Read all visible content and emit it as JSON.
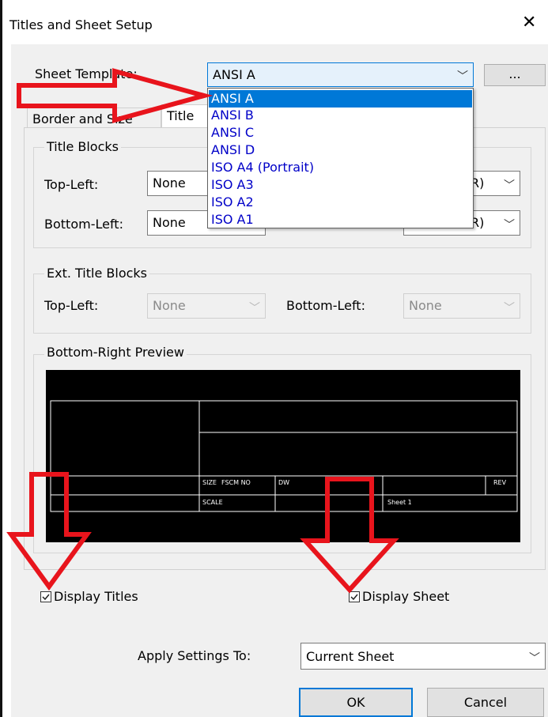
{
  "window": {
    "title": "Titles and Sheet Setup",
    "close_glyph": "✕"
  },
  "sheet_template": {
    "label": "Sheet Template:",
    "selected": "ANSI A",
    "more_button": "...",
    "options": [
      "ANSI A",
      "ANSI B",
      "ANSI C",
      "ANSI D",
      "ISO A4 (Portrait)",
      "ISO A3",
      "ISO A2",
      "ISO A1"
    ]
  },
  "tabs": [
    {
      "label": "Border and Size"
    },
    {
      "label": "Title"
    }
  ],
  "title_blocks": {
    "legend": "Title Blocks",
    "top_left_label": "Top-Left:",
    "top_left_value": "None",
    "bottom_left_label": "Bottom-Left:",
    "bottom_left_value": "None",
    "top_right_partial": "R)",
    "bottom_right_partial": "R)"
  },
  "ext_title_blocks": {
    "legend": "Ext. Title Blocks",
    "top_left_label": "Top-Left:",
    "top_left_value": "None",
    "bottom_left_label": "Bottom-Left:",
    "bottom_left_value": "None"
  },
  "preview": {
    "legend": "Bottom-Right Preview",
    "cells": {
      "size": "SIZE",
      "fscm": "FSCM NO",
      "dwg": "DW",
      "rev": "REV",
      "scale": "SCALE",
      "sheet": "Sheet 1"
    }
  },
  "display_titles": {
    "label": "Display Titles",
    "checked": true
  },
  "display_sheet": {
    "label": "Display Sheet",
    "checked": true
  },
  "apply_settings": {
    "label": "Apply Settings To:",
    "value": "Current Sheet"
  },
  "buttons": {
    "ok": "OK",
    "cancel": "Cancel"
  },
  "colors": {
    "selection": "#0078d7",
    "dropdown_text": "#0000c8",
    "arrow": "#e8141c"
  },
  "icons": {
    "chevron": "chevron-down-icon",
    "checkmark": "checkmark-icon",
    "close": "close-icon"
  }
}
